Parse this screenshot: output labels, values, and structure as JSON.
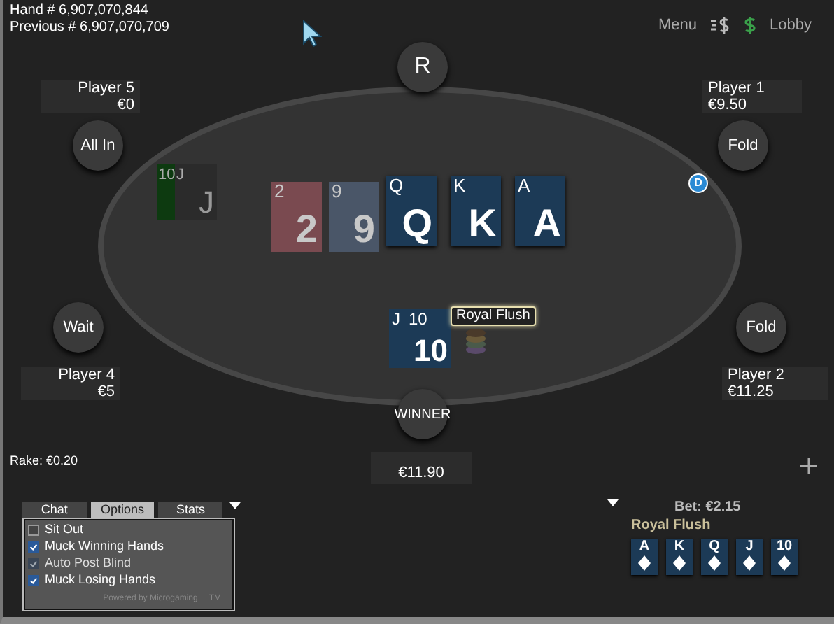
{
  "hand_info": {
    "hand": "Hand # 6,907,070,844",
    "previous": "Previous # 6,907,070,709"
  },
  "top_menu": {
    "menu": "Menu",
    "lobby": "Lobby"
  },
  "dealer_seat": {
    "label": "R"
  },
  "seats": [
    {
      "name": "Player 5",
      "balance": "€0",
      "action": "All In"
    },
    {
      "name": "Player 1",
      "balance": "€9.50",
      "action": "Fold"
    },
    {
      "name": "Player 4",
      "balance": "€5",
      "action": "Wait"
    },
    {
      "name": "Player 2",
      "balance": "€11.25",
      "action": "Fold"
    }
  ],
  "dealer_button": {
    "label": "D"
  },
  "player5_cards": [
    {
      "corner": "10",
      "color": "#0d3a10"
    },
    {
      "corner": "J",
      "center": "J",
      "color": "#2b2b2b"
    }
  ],
  "board": [
    {
      "corner": "2",
      "center": "2",
      "color": "#7a4a50",
      "selected": false
    },
    {
      "corner": "9",
      "center": "9",
      "color": "#4a5668",
      "selected": false
    },
    {
      "corner": "Q",
      "center": "Q",
      "color": "#1c3a56",
      "selected": true
    },
    {
      "corner": "K",
      "center": "K",
      "color": "#1c3a56",
      "selected": true
    },
    {
      "corner": "A",
      "center": "A",
      "color": "#1c3a56",
      "selected": true
    }
  ],
  "winner_cards": [
    {
      "corner": "J"
    },
    {
      "corner": "10",
      "center": "10"
    }
  ],
  "hand_tag": "Royal Flush",
  "winner_seat": {
    "label": "WINNER",
    "amount": "€11.90"
  },
  "rake": "Rake: €0.20",
  "options_panel": {
    "tabs": [
      {
        "label": "Chat",
        "selected": false
      },
      {
        "label": "Options",
        "selected": true
      },
      {
        "label": "Stats",
        "selected": false
      }
    ],
    "options": [
      {
        "label": "Sit Out",
        "checked": false,
        "disabled": false
      },
      {
        "label": "Muck Winning Hands",
        "checked": true,
        "disabled": false
      },
      {
        "label": "Auto Post Blind",
        "checked": true,
        "disabled": true
      },
      {
        "label": "Muck Losing Hands",
        "checked": true,
        "disabled": false
      }
    ],
    "powered_by": "Powered by Microgaming",
    "trademark": "TM"
  },
  "bet_panel": {
    "bet": "Bet: €2.15",
    "hand_name": "Royal Flush",
    "cards": [
      {
        "rank": "A"
      },
      {
        "rank": "K"
      },
      {
        "rank": "Q"
      },
      {
        "rank": "J"
      },
      {
        "rank": "10"
      }
    ]
  }
}
